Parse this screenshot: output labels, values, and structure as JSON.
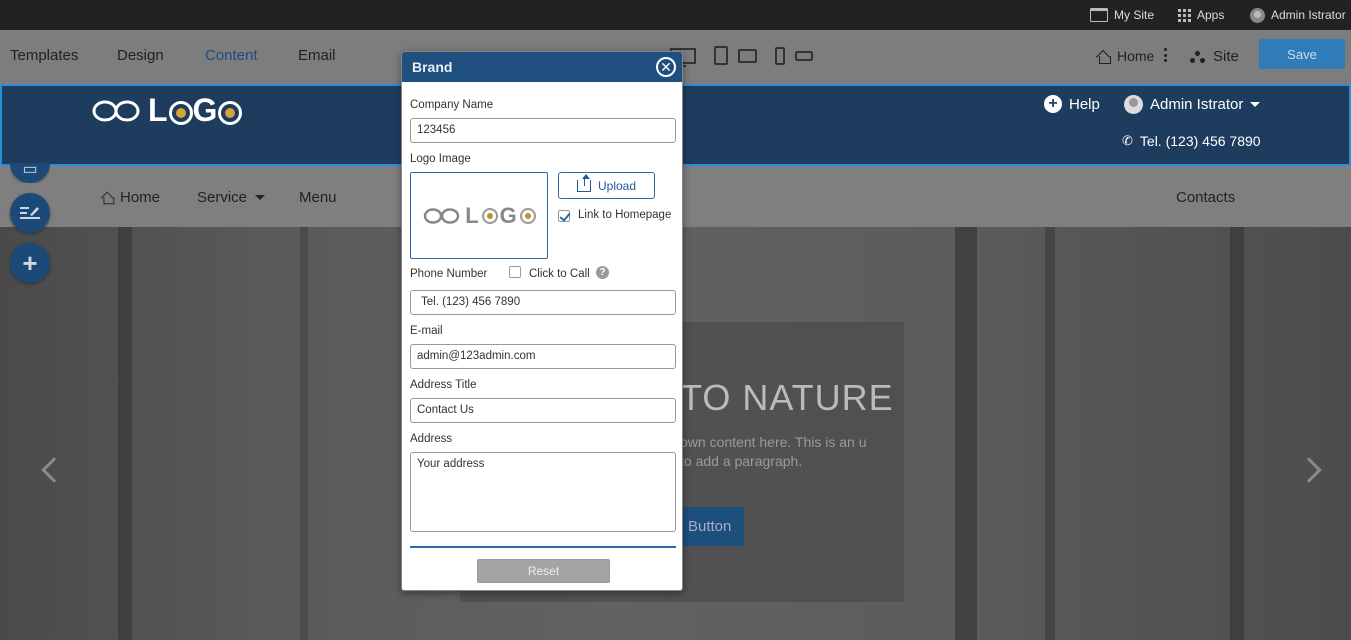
{
  "topbar": {
    "my_site": "My Site",
    "apps": "Apps",
    "user": "Admin Istrator"
  },
  "toolbar": {
    "tabs": [
      "Templates",
      "Design",
      "Content",
      "Email"
    ],
    "active_tab": "Content",
    "home": "Home",
    "site": "Site",
    "save": "Save"
  },
  "site_header": {
    "logo_text": "L GO",
    "help": "Help",
    "user": "Admin Istrator",
    "phone": "Tel. (123) 456 7890"
  },
  "nav": {
    "items": [
      "Home",
      "Service",
      "Menu",
      "Contacts"
    ]
  },
  "hero": {
    "title": "TO NATURE",
    "paragraph": "own content here. This is an u to add a paragraph.",
    "button": "Button"
  },
  "modal": {
    "title": "Brand",
    "company_name_label": "Company Name",
    "company_name_value": "123456",
    "logo_image_label": "Logo Image",
    "upload": "Upload",
    "link_homepage": "Link to Homepage",
    "link_homepage_checked": true,
    "phone_label": "Phone Number",
    "click_to_call": "Click to Call",
    "click_to_call_checked": false,
    "phone_value": "Tel. (123) 456 7890",
    "email_label": "E-mail",
    "email_value": "admin@123admin.com",
    "address_title_label": "Address Title",
    "address_title_value": "Contact Us",
    "address_label": "Address",
    "address_value": "Your address",
    "reset": "Reset"
  },
  "colors": {
    "accent": "#1e4f7f",
    "header_bg": "#1e3c5e",
    "save_bg": "#2f7cb8"
  }
}
